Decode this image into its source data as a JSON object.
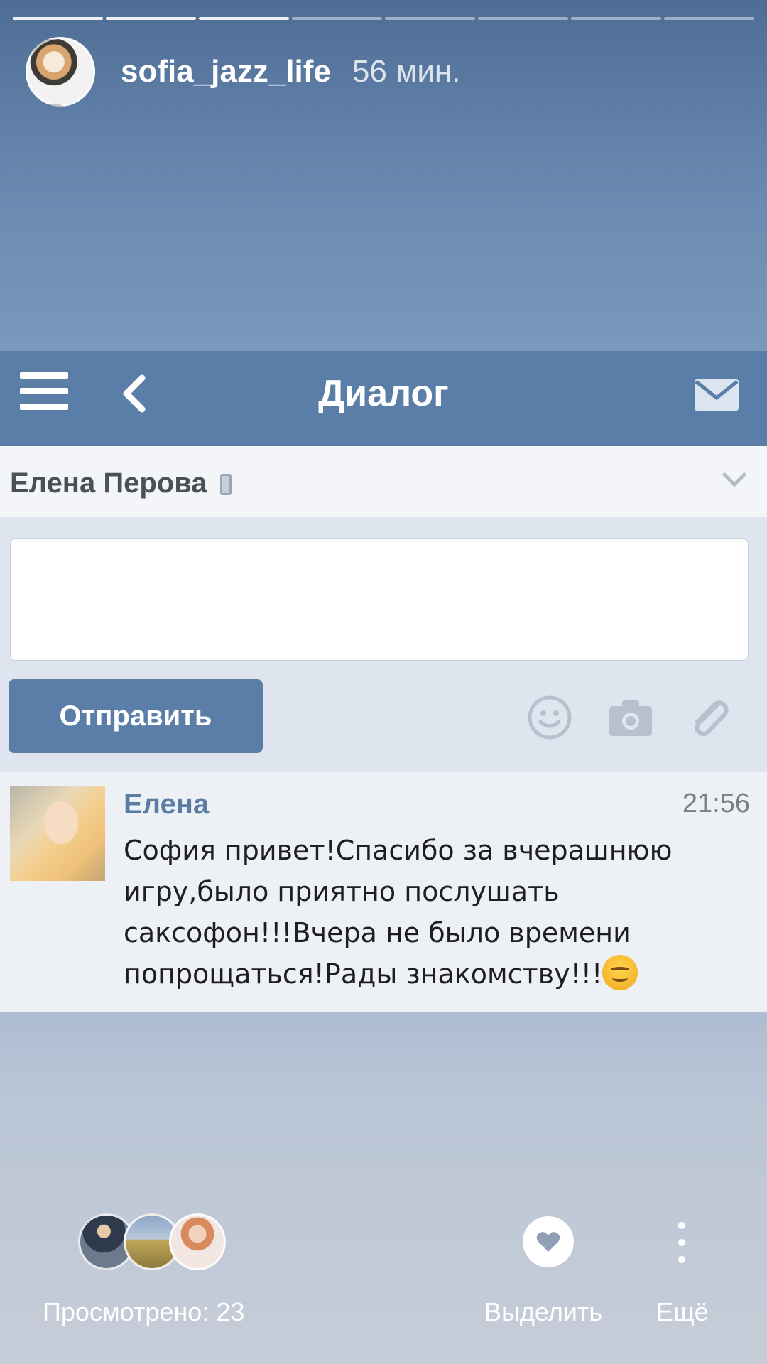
{
  "story": {
    "username": "sofia_jazz_life",
    "time": "56 мин."
  },
  "vk": {
    "title": "Диалог",
    "contact_name": "Елена Перова",
    "input_placeholder": "",
    "send_label": "Отправить",
    "message": {
      "author": "Елена",
      "time": "21:56",
      "text": "София привет!Спасибо за вчерашнюю игру,было приятно послушать саксофон!!!Вчера не было времени попрощаться!Рады знакомству!!!"
    }
  },
  "footer": {
    "viewed_label": "Просмотрено: 23",
    "highlight_label": "Выделить",
    "more_label": "Ещё"
  },
  "colors": {
    "vk_header": "#5b7ea9",
    "author_link": "#597da3"
  },
  "icons": [
    "menu-icon",
    "back-icon",
    "mail-icon",
    "phone-icon",
    "chevron-down-icon",
    "smile-icon",
    "camera-icon",
    "paperclip-icon",
    "heart-icon",
    "more-vertical-icon"
  ]
}
